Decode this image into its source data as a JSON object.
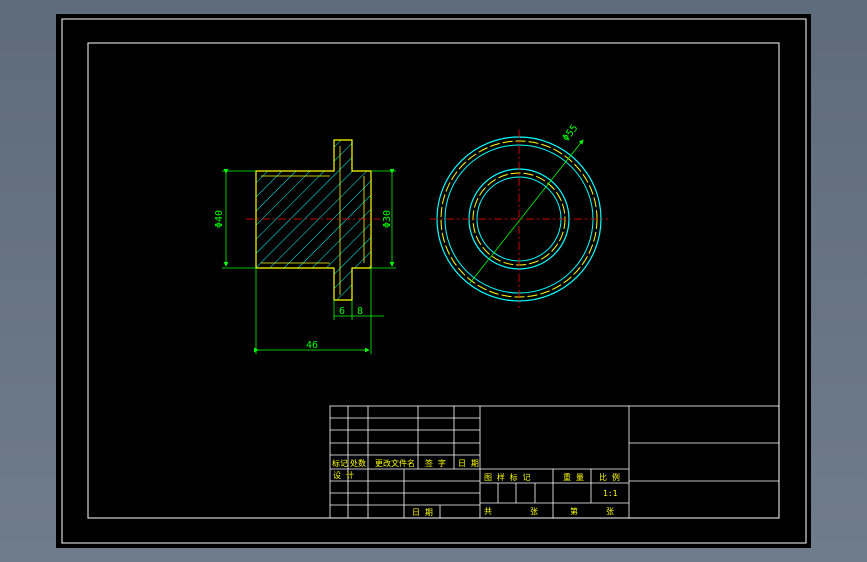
{
  "drawing": {
    "dimensions": {
      "dia_left": "Φ40",
      "dia_right": "Φ30",
      "flange_thk": "6",
      "flange_offset": "8",
      "overall_length": "46",
      "circle_dia": "Φ55"
    },
    "title_block": {
      "rev_row_labels": [
        "标记",
        "处数",
        "更改文件名",
        "签 字",
        "日 期"
      ],
      "design_label": "设 计",
      "date_label": "日 期",
      "stage_headers": [
        "图 样 标 记",
        "重 量",
        "比 例"
      ],
      "scale_value": "1:1",
      "sheet_row": [
        "共",
        "张",
        "第",
        "张"
      ]
    },
    "colors": {
      "background": "#000000",
      "frame": "#ffffff",
      "outline": "#ffff00",
      "hatch": "#00ffff",
      "dimension": "#00ff00",
      "centerline": "#ff0000",
      "table_text": "#ffff00"
    }
  }
}
